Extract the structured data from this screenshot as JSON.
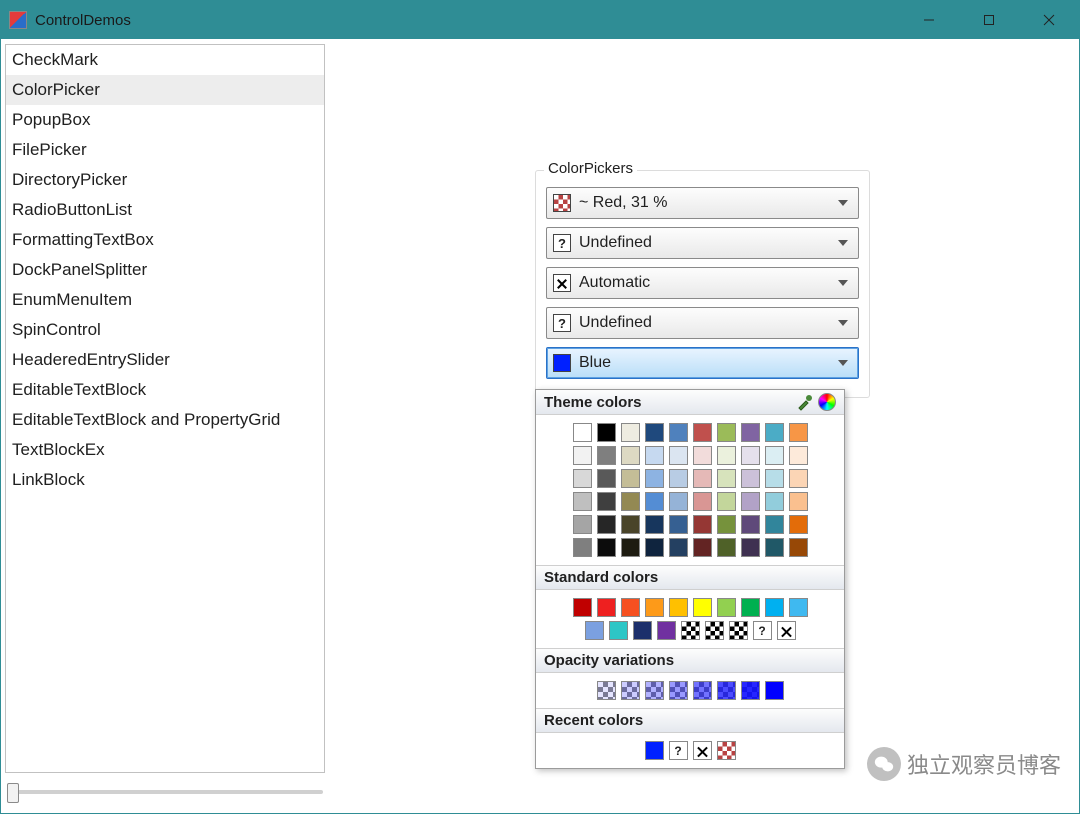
{
  "window": {
    "title": "ControlDemos"
  },
  "sidebar": {
    "items": [
      "CheckMark",
      "ColorPicker",
      "PopupBox",
      "FilePicker",
      "DirectoryPicker",
      "RadioButtonList",
      "FormattingTextBox",
      "DockPanelSplitter",
      "EnumMenuItem",
      "SpinControl",
      "HeaderedEntrySlider",
      "EditableTextBlock",
      "EditableTextBlock and PropertyGrid",
      "TextBlockEx",
      "LinkBlock"
    ],
    "selected_index": 1
  },
  "groupbox": {
    "label": "ColorPickers",
    "pickers": [
      {
        "icon": "checker",
        "label": "~ Red, 31 %"
      },
      {
        "icon": "question",
        "label": "Undefined"
      },
      {
        "icon": "cross",
        "label": "Automatic"
      },
      {
        "icon": "question",
        "label": "Undefined"
      },
      {
        "icon": "solid",
        "label": "Blue",
        "active": true
      }
    ]
  },
  "popup": {
    "theme_label": "Theme colors",
    "standard_label": "Standard colors",
    "opacity_label": "Opacity variations",
    "recent_label": "Recent colors",
    "theme_rows": [
      [
        "#ffffff",
        "#000000",
        "#eeece1",
        "#1f497d",
        "#4f81bd",
        "#c0504d",
        "#9bbb59",
        "#8064a2",
        "#4bacc6",
        "#f79646"
      ],
      [
        "#f2f2f2",
        "#7f7f7f",
        "#ddd9c3",
        "#c6d9f0",
        "#dbe5f1",
        "#f2dcdb",
        "#ebf1dd",
        "#e5e0ec",
        "#dbeef3",
        "#fdeada"
      ],
      [
        "#d8d8d8",
        "#595959",
        "#c4bd97",
        "#8db3e2",
        "#b8cce4",
        "#e5b9b7",
        "#d7e3bc",
        "#ccc1d9",
        "#b7dde8",
        "#fbd5b5"
      ],
      [
        "#bfbfbf",
        "#3f3f3f",
        "#938953",
        "#548dd4",
        "#95b3d7",
        "#d99694",
        "#c3d69b",
        "#b2a2c7",
        "#92cddc",
        "#fac08f"
      ],
      [
        "#a5a5a5",
        "#262626",
        "#494429",
        "#17365d",
        "#366092",
        "#953734",
        "#76923c",
        "#5f497a",
        "#31859b",
        "#e36c09"
      ],
      [
        "#7f7f7f",
        "#0c0c0c",
        "#1d1b10",
        "#0f243e",
        "#244061",
        "#632423",
        "#4f6128",
        "#3f3151",
        "#205867",
        "#974806"
      ]
    ],
    "standard_rows": [
      [
        "#c00000",
        "#ee2020",
        "#f65020",
        "#fd9a19",
        "#ffc000",
        "#ffff00",
        "#92d050",
        "#00b050",
        "#00b0f0",
        "#3fb9f0"
      ],
      [
        "#7ba0e0",
        "#2dc6c6",
        "#1c2f6b",
        "#7030a0",
        "chk",
        "chk",
        "chk",
        "q",
        "x"
      ]
    ],
    "opacity_values": [
      "0.10",
      "0.20",
      "0.30",
      "0.40",
      "0.55",
      "0.70",
      "0.85",
      "1.00"
    ],
    "opacity_base": "#0000ff",
    "recent": [
      {
        "type": "color",
        "value": "#0020ff"
      },
      {
        "type": "q"
      },
      {
        "type": "x"
      },
      {
        "type": "checker_red"
      }
    ]
  },
  "watermark": {
    "text": "独立观察员博客"
  }
}
